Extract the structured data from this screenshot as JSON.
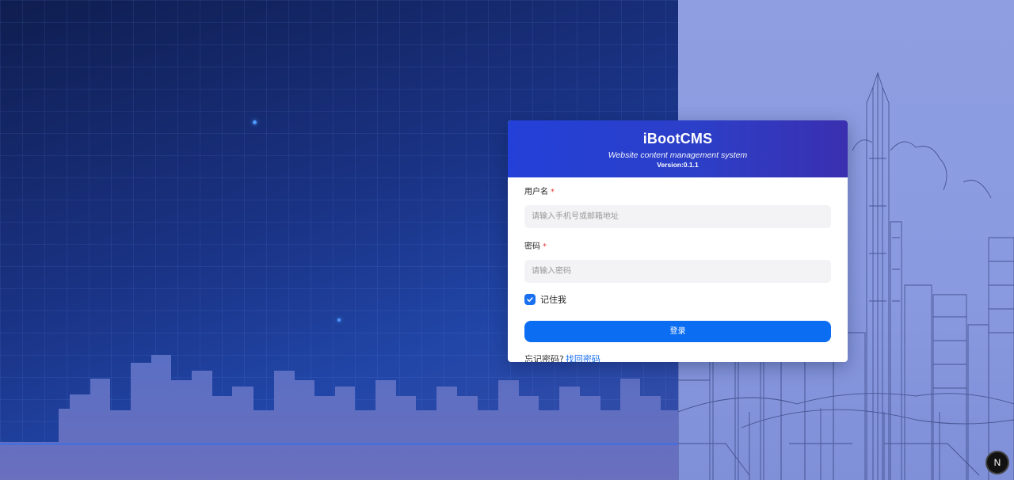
{
  "header": {
    "brand": "iBootCMS",
    "subtitle": "Website content management system",
    "version": "Version:0.1.1"
  },
  "form": {
    "username_label": "用户名",
    "username_placeholder": "请输入手机号或邮箱地址",
    "password_label": "密码",
    "password_placeholder": "请输入密码",
    "required_mark": "*",
    "remember_label": "记住我",
    "remember_checked": true,
    "login_button": "登录",
    "forgot_text": "忘记密码?",
    "forgot_link": "找回密码"
  },
  "badge": {
    "label": "N"
  },
  "colors": {
    "primary": "#0b6df2",
    "header_start": "#2340d8",
    "header_end": "#3a2fb0",
    "required": "#e53935"
  }
}
